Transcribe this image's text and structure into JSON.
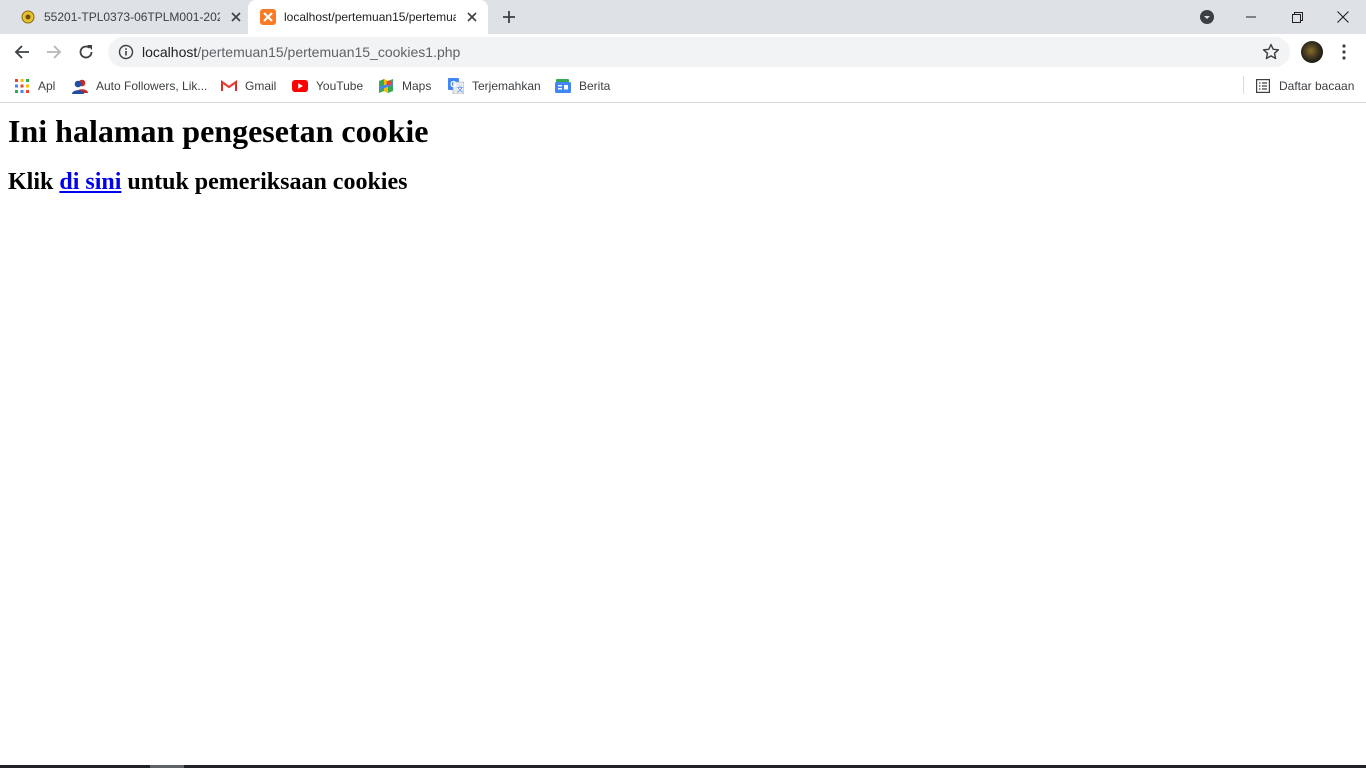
{
  "tabs": [
    {
      "title": "55201-TPL0373-06TPLM001-2020",
      "favicon": "campus-logo-icon",
      "active": false
    },
    {
      "title": "localhost/pertemuan15/pertemuan15_cookies1.php",
      "favicon": "xampp-icon",
      "active": true
    }
  ],
  "omnibox": {
    "host": "localhost",
    "path": "/pertemuan15/pertemuan15_cookies1.php"
  },
  "bookmarks": [
    {
      "label": "Apl",
      "icon": "apps-grid-icon"
    },
    {
      "label": "Auto Followers, Lik...",
      "icon": "users-icon"
    },
    {
      "label": "Gmail",
      "icon": "gmail-icon"
    },
    {
      "label": "YouTube",
      "icon": "youtube-icon"
    },
    {
      "label": "Maps",
      "icon": "maps-icon"
    },
    {
      "label": "Terjemahkan",
      "icon": "translate-icon"
    },
    {
      "label": "Berita",
      "icon": "news-icon"
    }
  ],
  "reading_list": {
    "label": "Daftar bacaan",
    "icon": "reading-list-icon"
  },
  "page": {
    "heading": "Ini halaman pengesetan cookie",
    "line_prefix": "Klik ",
    "link_text": "di sini",
    "line_suffix": " untuk pemeriksaan cookies"
  },
  "colors": {
    "link": "#0000ee",
    "tabstrip": "#dee1e6",
    "omnibox": "#f1f3f4"
  }
}
